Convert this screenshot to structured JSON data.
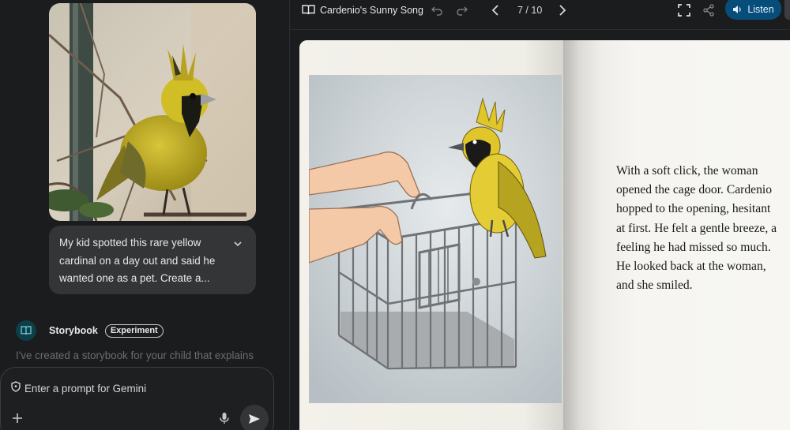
{
  "chat": {
    "user_message": "My kid spotted this rare yellow cardinal on a day out and said he wanted one as a pet. Create a...",
    "response": {
      "app_name": "Storybook",
      "badge": "Experiment",
      "preview_text": "I've created a storybook for your child that explains"
    },
    "prompt": {
      "placeholder": "Enter a prompt for Gemini"
    }
  },
  "storybook": {
    "title": "Cardenio's Sunny Song",
    "page_indicator": "7 / 10",
    "listen_label": "Listen",
    "page_text": "With a soft click, the woman opened the cage door. Cardenio hopped to the opening, hesitant at first. He felt a gentle breeze, a feeling he had missed so much. He looked back at the woman, and she smiled."
  },
  "colors": {
    "background": "#1b1c1d",
    "bubble": "#333537",
    "accent_listen": "#074d7a",
    "storybook_icon_bg": "#0c3f48",
    "page_paper": "#f4f3ee"
  },
  "icons": [
    "expand-chevron-icon",
    "book-icon",
    "shield-icon",
    "plus-icon",
    "mic-icon",
    "send-icon",
    "undo-icon",
    "redo-icon",
    "chevron-left-icon",
    "chevron-right-icon",
    "fullscreen-icon",
    "share-icon",
    "speaker-icon"
  ]
}
